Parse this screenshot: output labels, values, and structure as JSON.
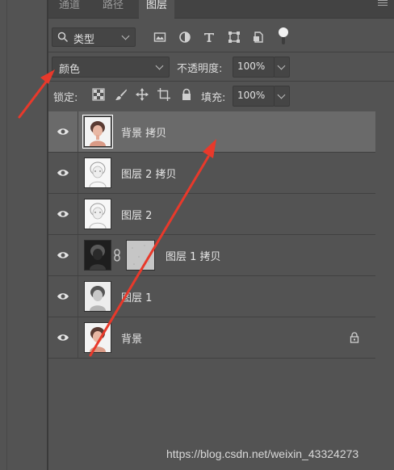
{
  "tabs": [
    {
      "label": "通道",
      "active": false
    },
    {
      "label": "路径",
      "active": false
    },
    {
      "label": "图层",
      "active": true
    }
  ],
  "filter": {
    "kind_label": "类型",
    "icons": [
      "image-filter-icon",
      "adjustment-filter-icon",
      "type-filter-icon",
      "shape-filter-icon",
      "smart-object-filter-icon",
      "filter-toggle-icon"
    ]
  },
  "blend": {
    "mode": "颜色",
    "opacity_label": "不透明度:",
    "opacity_value": "100%"
  },
  "lock": {
    "label": "锁定:",
    "icons": [
      "lock-transparent-pixels-icon",
      "lock-image-pixels-icon",
      "lock-position-icon",
      "lock-artboard-icon",
      "lock-all-icon"
    ],
    "fill_label": "填充:",
    "fill_value": "100%"
  },
  "layers": [
    {
      "name": "背景 拷贝",
      "selected": true,
      "thumb": "color",
      "has_mask": false,
      "locked": false
    },
    {
      "name": "图层 2 拷贝",
      "selected": false,
      "thumb": "sketch",
      "has_mask": false,
      "locked": false
    },
    {
      "name": "图层 2",
      "selected": false,
      "thumb": "sketch",
      "has_mask": false,
      "locked": false
    },
    {
      "name": "图层 1 拷贝",
      "selected": false,
      "thumb": "dark",
      "has_mask": true,
      "locked": false
    },
    {
      "name": "图层 1",
      "selected": false,
      "thumb": "gray",
      "has_mask": false,
      "locked": false
    },
    {
      "name": "背景",
      "selected": false,
      "thumb": "color",
      "has_mask": false,
      "locked": true
    }
  ],
  "watermark": "https://blog.csdn.net/weixin_43324273",
  "colors": {
    "panel_bg": "#535353",
    "selected_row": "#6a6a6a",
    "annotation_arrow": "#e8392b"
  }
}
